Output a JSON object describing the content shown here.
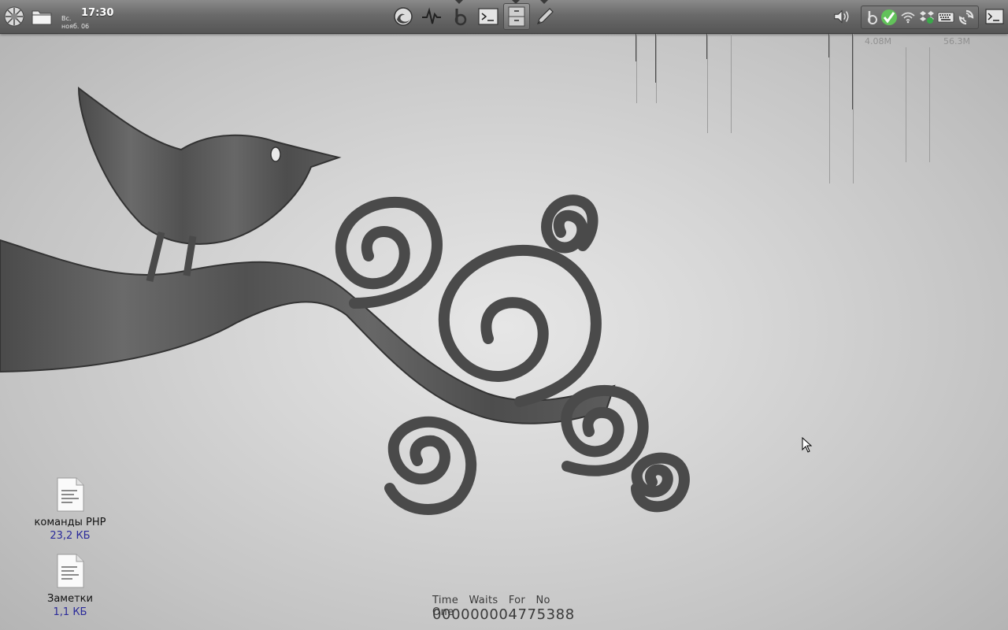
{
  "panel": {
    "clock": {
      "time": "17:30",
      "day": "Вс.",
      "date": "нояб. 06"
    },
    "launchers": [
      {
        "name": "firefox-icon"
      },
      {
        "name": "system-monitor-icon"
      },
      {
        "name": "beep-icon"
      },
      {
        "name": "terminal-icon"
      },
      {
        "name": "file-cabinet-icon"
      },
      {
        "name": "pen-icon"
      }
    ],
    "tray": [
      {
        "name": "volume-icon"
      },
      {
        "name": "beep-tray-icon"
      },
      {
        "name": "checkmark-icon"
      },
      {
        "name": "wifi-icon"
      },
      {
        "name": "dropbox-icon"
      },
      {
        "name": "keyboard-icon"
      },
      {
        "name": "update-icon"
      },
      {
        "name": "terminal-icon"
      }
    ]
  },
  "conky": {
    "down_rate": "4.08M",
    "up_rate": "56.3M"
  },
  "desktop_icons": [
    {
      "label": "команды PHP",
      "size": "23,2 КБ"
    },
    {
      "label": "Заметки",
      "size": "1,1 КБ"
    }
  ],
  "widget": {
    "motto": "Time Waits For No One",
    "counter": "000000004775388"
  }
}
